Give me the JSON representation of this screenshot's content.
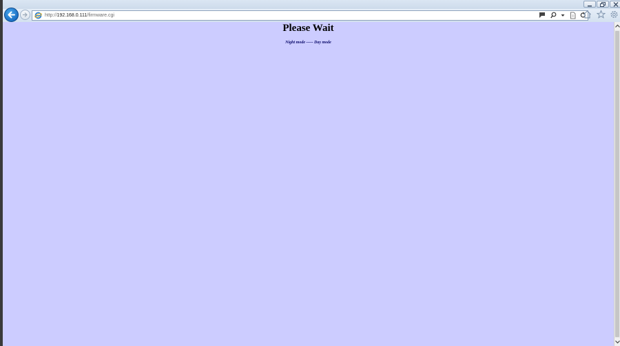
{
  "browser": {
    "address": {
      "scheme": "http://",
      "host": "192.168.0.111",
      "path": "/firmware.cgi"
    },
    "icons": {
      "back": "arrow-left-icon",
      "forward": "arrow-right-icon",
      "site": "ie-logo-icon",
      "compat": "compatibility-view-icon",
      "search": "search-icon",
      "dropdown": "chevron-down-icon",
      "page": "page-icon",
      "refresh": "refresh-icon",
      "home": "home-icon",
      "favorites": "star-icon",
      "tools": "gear-icon"
    },
    "window_controls": [
      "minimize",
      "restore",
      "close"
    ]
  },
  "page": {
    "heading": "Please Wait",
    "status": "Night mode ----- Day mode",
    "background": "#ccccff"
  }
}
